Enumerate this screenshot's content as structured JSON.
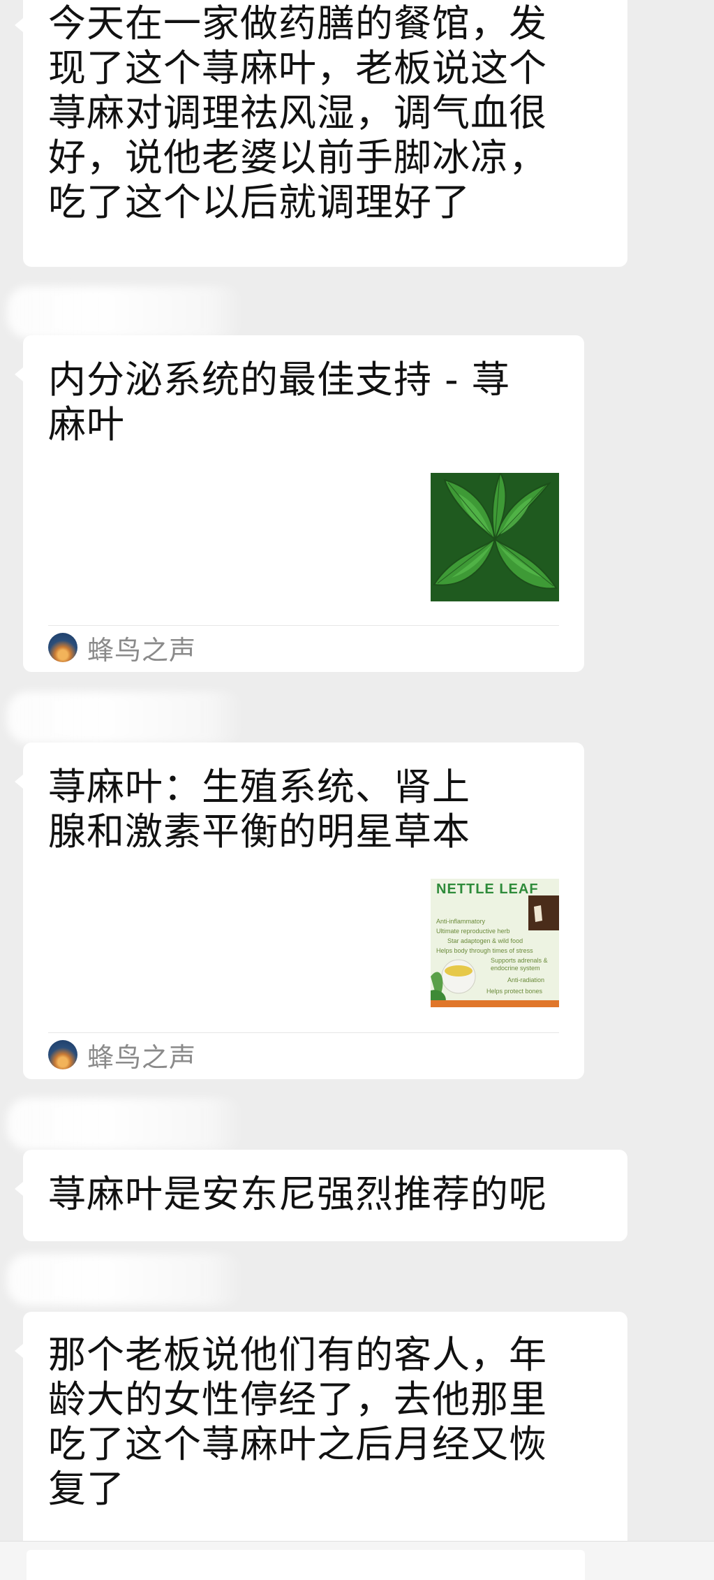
{
  "messages": [
    {
      "type": "text",
      "text": "今天在一家做药膳的餐馆，发\n现了这个荨麻叶，老板说这个\n荨麻对调理祛风湿，调气血很\n好，说他老婆以前手脚冰凉，\n吃了这个以后就调理好了"
    },
    {
      "type": "link",
      "title": "内分泌系统的最佳支持 - 荨\n麻叶",
      "thumbnail_icon": "nettle-leaves-photo",
      "source": "蜂鸟之声"
    },
    {
      "type": "link",
      "title": "荨麻叶：生殖系统、肾上\n腺和激素平衡的明星草本",
      "thumbnail_icon": "nettle-leaf-infographic",
      "thumbnail_heading": "NETTLE LEAF",
      "thumbnail_lines": [
        "Anti-inflammatory",
        "Ultimate reproductive herb",
        "Star adaptogen & wild food",
        "Helps body through times of stress",
        "Supports adrenals & endocrine system",
        "Anti-radiation",
        "Helps protect bones"
      ],
      "source": "蜂鸟之声"
    },
    {
      "type": "text",
      "text": "荨麻叶是安东尼强烈推荐的呢"
    },
    {
      "type": "text",
      "text": "那个老板说他们有的客人，年\n龄大的女性停经了，去他那里\n吃了这个荨麻叶之后月经又恢\n复了"
    }
  ],
  "colors": {
    "background": "#ededed",
    "bubble": "#ffffff",
    "text": "#111111",
    "source_text": "#8a8a8a",
    "infographic_heading": "#2e8b3a"
  }
}
